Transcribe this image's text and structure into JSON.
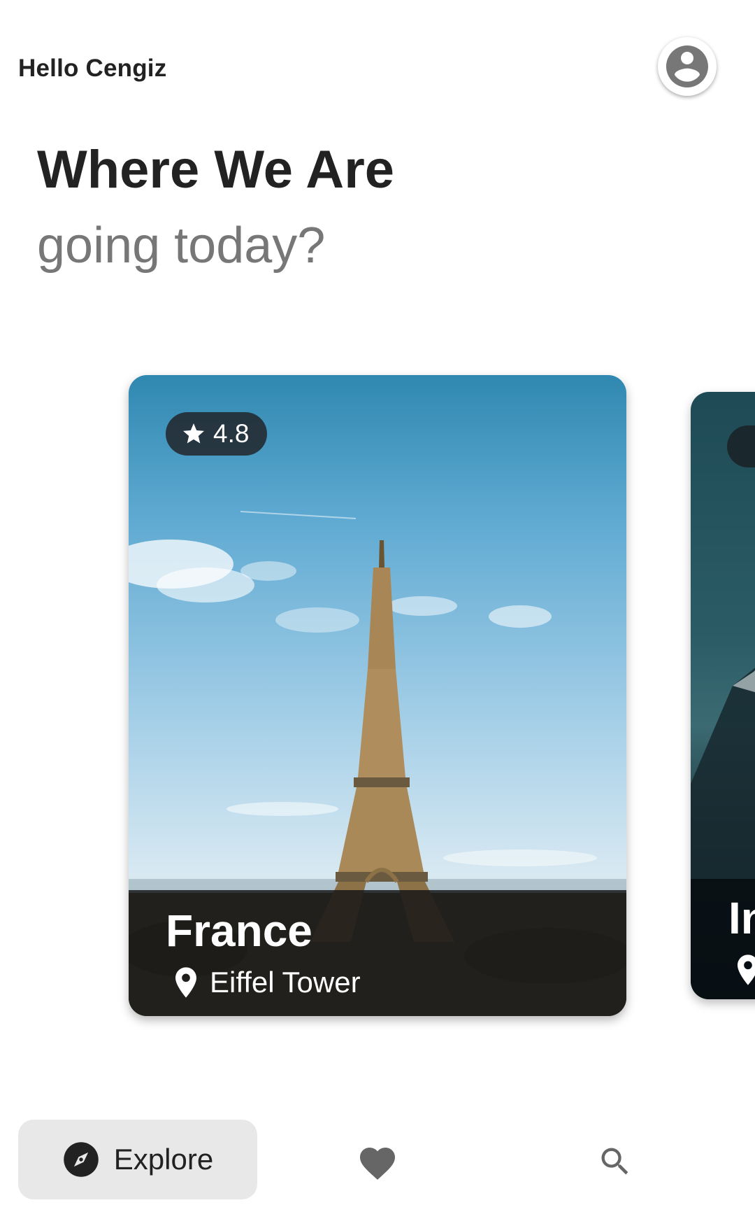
{
  "header": {
    "greeting": "Hello Cengiz",
    "avatar_icon": "account-circle-icon"
  },
  "hero": {
    "title": "Where We Are",
    "subtitle": "going today?"
  },
  "destinations": [
    {
      "rating": "4.8",
      "country": "France",
      "place": "Eiffel Tower"
    },
    {
      "country": "In"
    }
  ],
  "bottom_nav": {
    "explore_label": "Explore",
    "explore_icon": "compass-icon",
    "favorites_icon": "heart-icon",
    "search_icon": "search-icon"
  },
  "colors": {
    "text_primary": "#222222",
    "text_secondary": "#777777",
    "nav_active_bg": "#e8e8e8"
  }
}
